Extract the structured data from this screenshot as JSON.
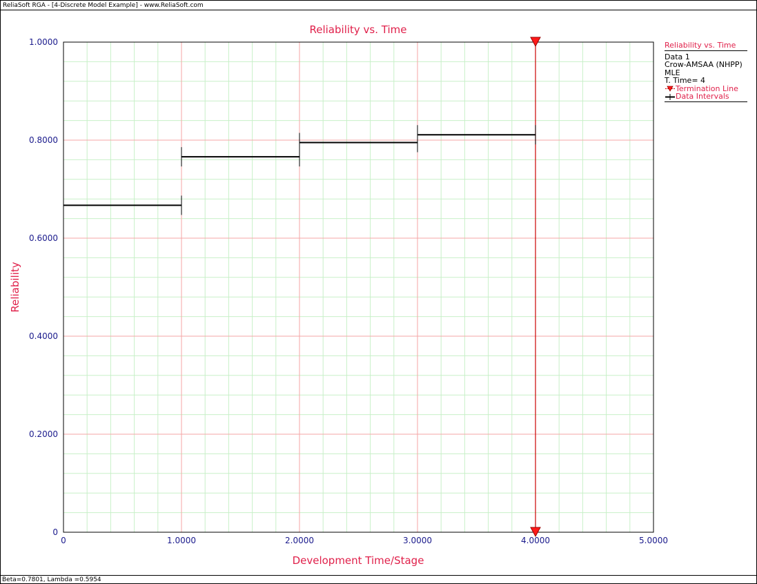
{
  "window": {
    "title": "ReliaSoft RGA - [4-Discrete Model Example] - www.ReliaSoft.com"
  },
  "status": {
    "text": "Beta=0.7801, Lambda =0.5954"
  },
  "colors": {
    "accent": "#e0204a",
    "axis_text": "#1a1a8c",
    "major_grid": "#f4a6a6",
    "minor_grid": "#c8f0c8",
    "termination": "#cc0000"
  },
  "legend": {
    "title": "Reliability vs. Time",
    "lines": [
      "Data 1",
      "Crow-AMSAA (NHPP)",
      "MLE",
      "T. Time= 4"
    ],
    "termination_label": "Termination Line",
    "intervals_label": "Data Intervals"
  },
  "chart_data": {
    "type": "line",
    "title": "Reliability vs. Time",
    "xlabel": "Development Time/Stage",
    "ylabel": "Reliability",
    "xlim": [
      0,
      5
    ],
    "ylim": [
      0,
      1
    ],
    "x_ticks": [
      0,
      1,
      2,
      3,
      4,
      5
    ],
    "x_tick_labels": [
      "0",
      "1.0000",
      "2.0000",
      "3.0000",
      "4.0000",
      "5.0000"
    ],
    "y_ticks": [
      0,
      0.2,
      0.4,
      0.6,
      0.8,
      1.0
    ],
    "y_tick_labels": [
      "0",
      "0.2000",
      "0.4000",
      "0.6000",
      "0.8000",
      "1.0000"
    ],
    "grid": true,
    "legend_position": "right",
    "intervals": [
      {
        "x_start": 0,
        "x_end": 1,
        "reliability": 0.667
      },
      {
        "x_start": 1,
        "x_end": 2,
        "reliability": 0.766
      },
      {
        "x_start": 2,
        "x_end": 3,
        "reliability": 0.795
      },
      {
        "x_start": 3,
        "x_end": 4,
        "reliability": 0.811
      }
    ],
    "termination_time": 4
  }
}
